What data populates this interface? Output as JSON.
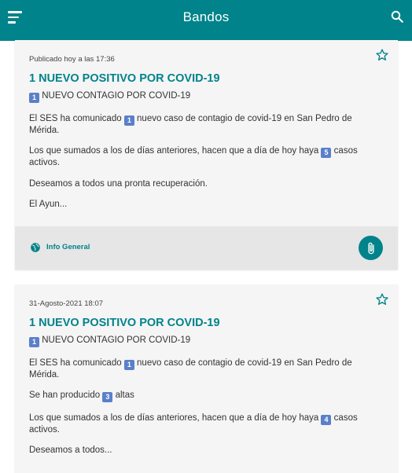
{
  "appbar": {
    "title": "Bandos",
    "menu_icon": "hamburger-menu-icon",
    "search_icon": "search-icon",
    "color": "#00838a"
  },
  "posts": [
    {
      "published": "Publicado hoy a las 17:36",
      "title": "1 NUEVO POSITIVO POR COVID-19",
      "subtitle_text": "NUEVO CONTAGIO POR COVID-19",
      "subtitle_badge": "1",
      "p1_a": "El SES ha comunicado",
      "p1_badge": "1",
      "p1_b": "nuevo caso de contagio de covid-19 en San Pedro de Mérida.",
      "p2_a": "Los que  sumados a los de días anteriores, hacen que a día de hoy haya",
      "p2_badge": "5",
      "p2_b": "casos activos.",
      "p3": "Deseamos a todos una pronta recuperación.",
      "p4": "El Ayun...",
      "category": "Info General"
    },
    {
      "published": "31-Agosto-2021 18:07",
      "title": "1 NUEVO POSITIVO POR COVID-19",
      "subtitle_text": "NUEVO CONTAGIO POR COVID-19",
      "subtitle_badge": "1",
      "p1_a": "El SES ha comunicado",
      "p1_badge": "1",
      "p1_b": "nuevo caso de contagio de covid-19 en San Pedro de Mérida.",
      "p2_a": "Se han producido",
      "p2_badge": "3",
      "p2_b": "altas",
      "p3_a": "Los que  sumados a los de días anteriores, hacen que a día de hoy haya",
      "p3_badge": "4",
      "p3_b": "casos activos.",
      "p4": "Deseamos a todos..."
    }
  ]
}
